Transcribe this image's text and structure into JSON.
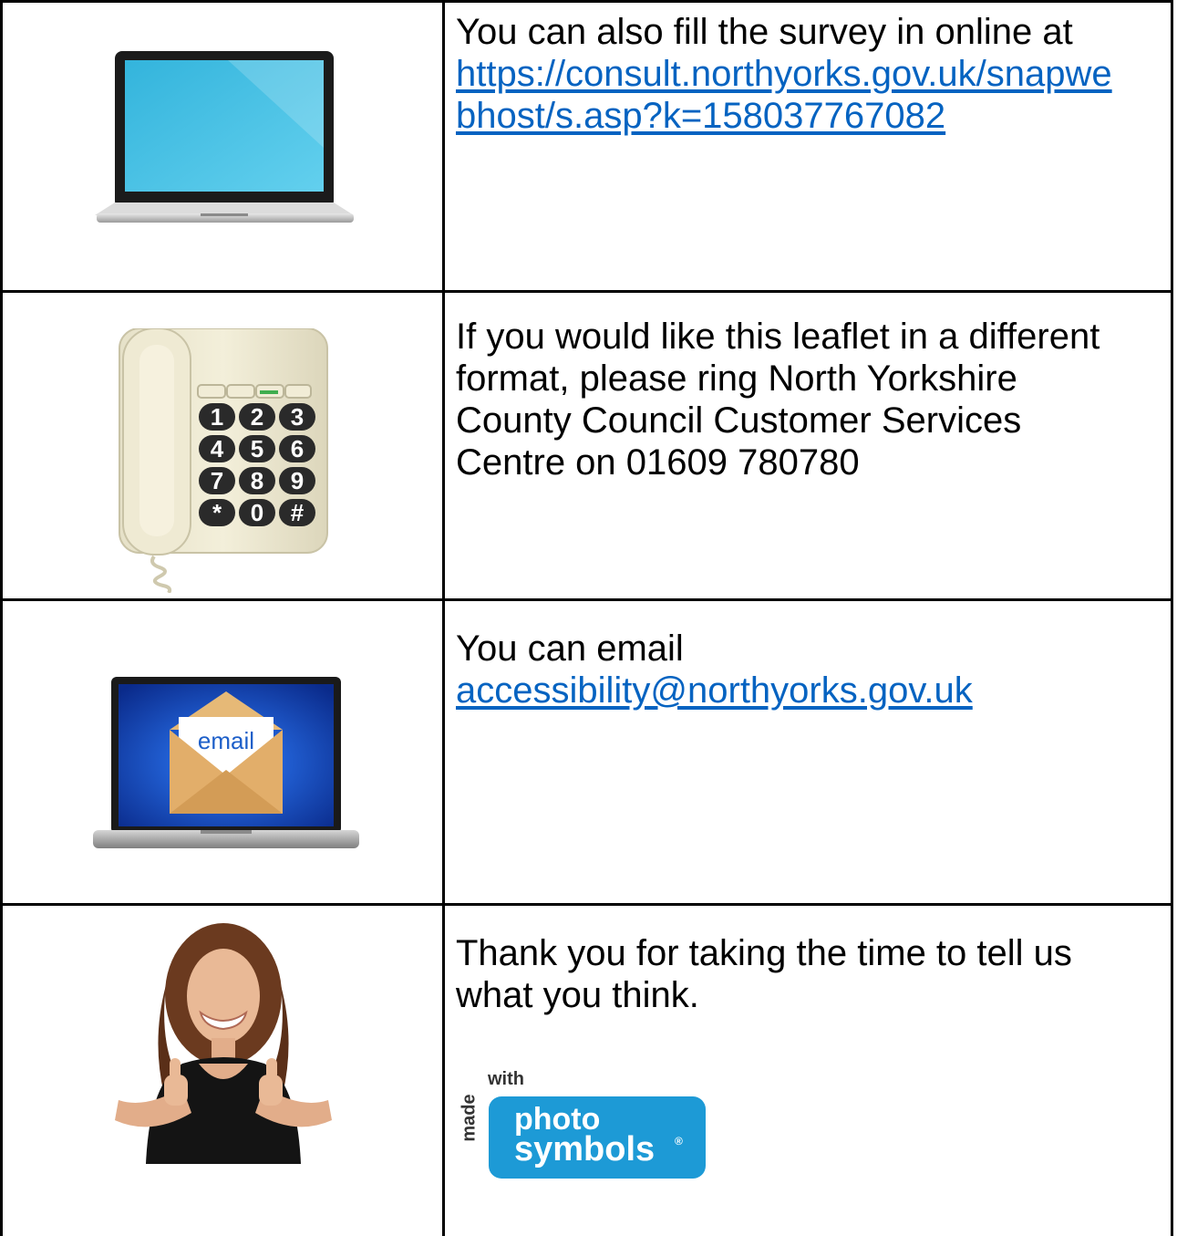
{
  "rows": [
    {
      "icon": "laptop-icon",
      "text": "You can also fill the survey in online at",
      "link": "https://consult.northyorks.gov.uk/snapwebhost/s.asp?k=158037767082",
      "link_line1": "https://consult.northyorks.gov.uk/snapwe",
      "link_line2": "bhost/s.asp?k=158037767082"
    },
    {
      "icon": "telephone-icon",
      "text": "If you would like this leaflet in a different format, please ring North Yorkshire County Council Customer Services Centre on 01609 780780",
      "lines": [
        "If you would like this leaflet in a different",
        "format, please ring North Yorkshire",
        "County Council Customer Services",
        "Centre on 01609 780780"
      ],
      "keypad": [
        "1",
        "2",
        "3",
        "4",
        "5",
        "6",
        "7",
        "8",
        "9",
        "*",
        "0",
        "#"
      ]
    },
    {
      "icon": "email-laptop-icon",
      "text": "You can email",
      "link": "accessibility@northyorks.gov.uk",
      "envelope_label": "email"
    },
    {
      "icon": "thumbs-up-person-icon",
      "lines": [
        "Thank you for taking the time to tell us",
        "what you think."
      ],
      "logo": {
        "made": "made",
        "with": "with",
        "line1": "photo",
        "line2": "symbols",
        "mark": "®"
      }
    }
  ],
  "colors": {
    "link": "#0563c1",
    "border": "#000000",
    "screen_blue": "#4fc3e6",
    "logo_blue": "#1d9ad6"
  }
}
